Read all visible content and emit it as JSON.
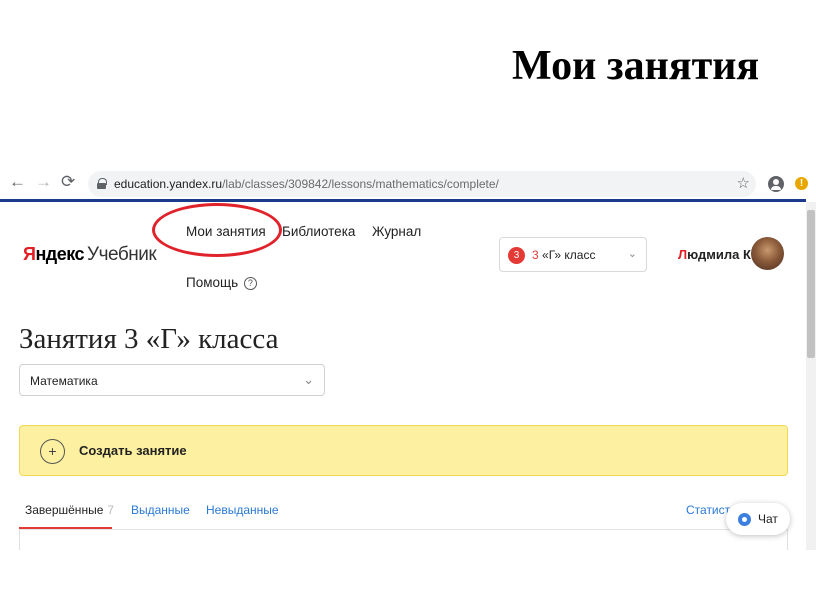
{
  "slide": {
    "title": "Мои занятия"
  },
  "browser": {
    "back": "←",
    "forward": "→",
    "reload": "⟳",
    "url_host": "education.yandex.ru",
    "url_path": "/lab/classes/309842/lessons/mathematics/complete/",
    "star": "☆",
    "alert": "!"
  },
  "header": {
    "logo_ya": "Я",
    "logo_rest": "ндекс",
    "logo_product": "Учебник",
    "nav": {
      "lessons": "Мои занятия",
      "library": "Библиотека",
      "journal": "Журнал",
      "help": "Помощь",
      "help_icon": "?"
    },
    "class_select": {
      "badge": "3",
      "num": "3",
      "label": " «Г» класс",
      "chevron": "⌄"
    },
    "user": {
      "first_letter": "Л",
      "name_rest": "юдмила К."
    }
  },
  "main": {
    "title": "Занятия 3 «Г» класса",
    "subject_select": {
      "value": "Математика",
      "chevron": "⌄"
    },
    "create": {
      "icon": "+",
      "label": "Создать занятие"
    },
    "tabs": {
      "completed": "Завершённые",
      "completed_count": "7",
      "issued": "Выданные",
      "unissued": "Невыданные",
      "stats": "Статист"
    },
    "chat": {
      "label": "Чат"
    }
  },
  "colors": {
    "brand_red": "#e31e24",
    "link_blue": "#2979d6",
    "panel_yellow": "#fdf0a0",
    "highlight": "#e0232b"
  }
}
